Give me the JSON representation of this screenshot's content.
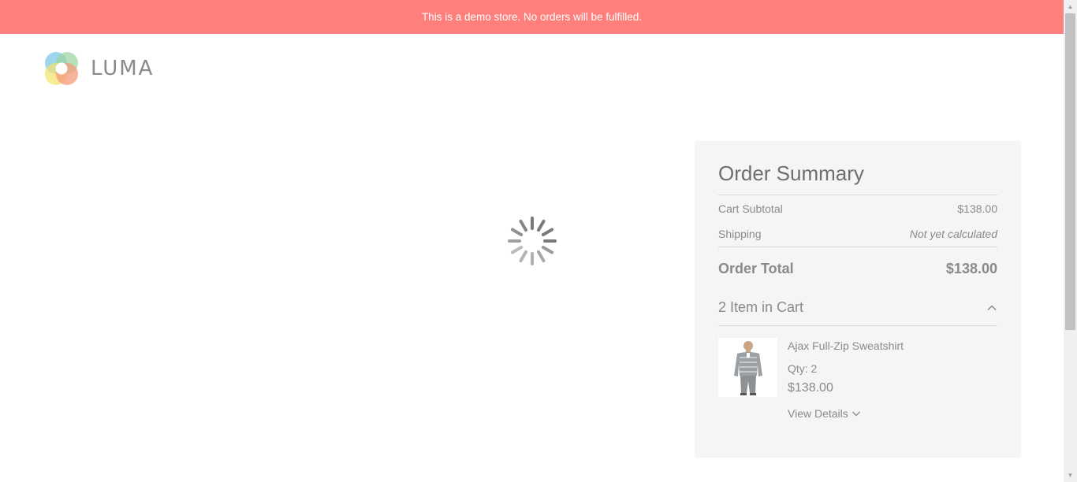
{
  "banner": {
    "text": "This is a demo store. No orders will be fulfilled."
  },
  "logo": {
    "text": "LUMA",
    "icon": "luma-logo-icon"
  },
  "loader": {
    "icon": "loading-spinner-icon"
  },
  "summary": {
    "title": "Order Summary",
    "subtotal_label": "Cart Subtotal",
    "subtotal_value": "$138.00",
    "shipping_label": "Shipping",
    "shipping_value": "Not yet calculated",
    "total_label": "Order Total",
    "total_value": "$138.00",
    "cart_toggle_label": "2 Item in Cart",
    "items": [
      {
        "name": "Ajax Full-Zip Sweatshirt",
        "qty_label": "Qty: 2",
        "price": "$138.00",
        "view_details_label": "View Details"
      }
    ]
  },
  "colors": {
    "banner_bg": "#ff7f7d",
    "summary_bg": "#f5f5f5",
    "muted_text": "#8a8a8a"
  }
}
